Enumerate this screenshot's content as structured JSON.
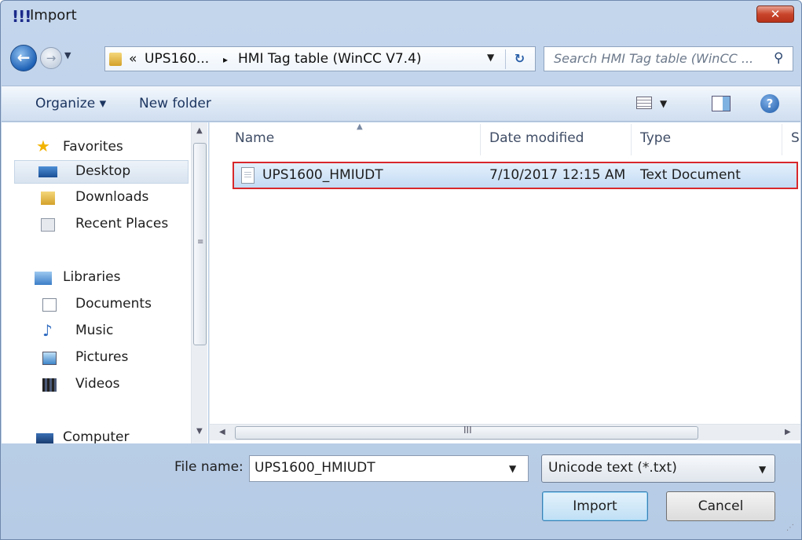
{
  "window": {
    "title": "Import",
    "app_icon": "!!!",
    "close_label": "✕"
  },
  "nav": {
    "back_icon": "back-arrow-icon",
    "forward_icon": "forward-arrow-icon",
    "breadcrumb": {
      "overflow": "«",
      "parent": "UPS160...",
      "sep": "▸",
      "current": "HMI Tag table (WinCC V7.4)"
    },
    "search_placeholder": "Search HMI Tag table (WinCC ..."
  },
  "toolbar": {
    "organize": "Organize ▾",
    "new_folder": "New folder"
  },
  "sidebar": {
    "favorites": {
      "label": "Favorites",
      "items": [
        "Desktop",
        "Downloads",
        "Recent Places"
      ]
    },
    "libraries": {
      "label": "Libraries",
      "items": [
        "Documents",
        "Music",
        "Pictures",
        "Videos"
      ]
    },
    "computer": "Computer"
  },
  "filelist": {
    "columns": {
      "name": "Name",
      "date": "Date modified",
      "type": "Type",
      "size": "S"
    },
    "rows": [
      {
        "name": "UPS1600_HMIUDT",
        "date": "7/10/2017 12:15 AM",
        "type": "Text Document"
      }
    ],
    "hscroll_grip": "III"
  },
  "footer": {
    "file_name_label": "File name:",
    "file_name_value": "UPS1600_HMIUDT",
    "file_type_value": "Unicode text (*.txt)",
    "import_label": "Import",
    "cancel_label": "Cancel"
  },
  "colors": {
    "selection_outline": "#d8282b",
    "window_frame": "#c4d6ec"
  }
}
